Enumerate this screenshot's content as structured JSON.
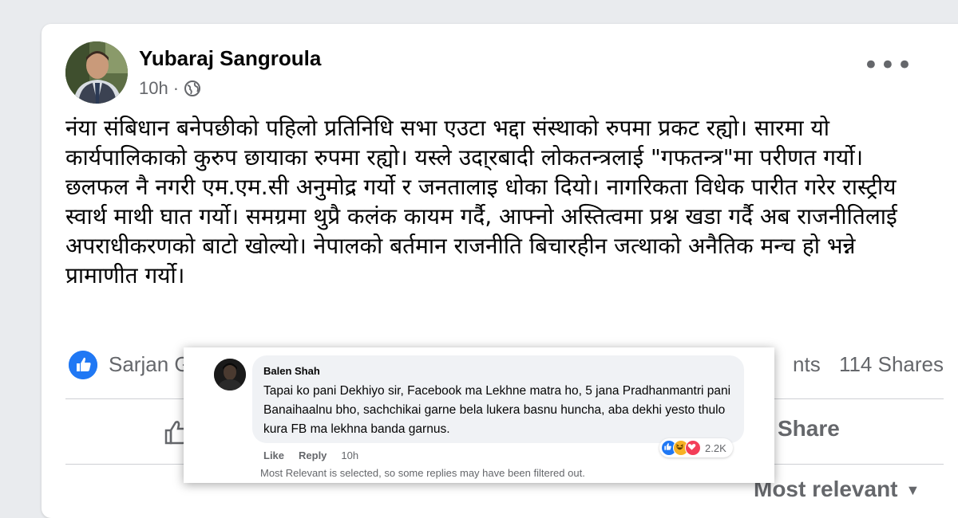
{
  "post": {
    "author": "Yubaraj Sangroula",
    "timestamp": "10h",
    "audience_icon": "globe-icon",
    "more_icon": "•••",
    "paragraph_1": "नंया संबिधान बनेपछीको पहिलो प्रतिनिधि सभा एउटा भद्दा संस्थाको रुपमा प्रकट रह्यो। सारमा यो कार्यपालिकाको कुरुप छायाका रुपमा रह्यो। यस्ले उदा्रबादी लोकतन्त्रलाई \"गफतन्त्र\"मा परीणत गर्यो।",
    "paragraph_2": "छलफल नै नगरी एम.एम.सी अनुमोद्र गर्यो र जनतालाइ धोका दियो। नागरिकता विधेक पारीत गरेर रास्ट्रीय स्वार्थ माथी घात गर्यो। समग्रमा थुप्रै कलंक कायम गर्दै, आफ्नो अस्तित्वमा प्रश्न खडा गर्दै अब राजनीतिलाई अपराधीकरणको बाटो खोल्यो। नेपालको बर्तमान राजनीति बिचारहीन जत्थाको अनैतिक मन्च हो भन्ने प्रामाणीत गर्यो।",
    "reactors_partial": "Sarjan G",
    "comments_partial": "nts",
    "shares": "114 Shares",
    "share_label": "Share",
    "sort_label": "Most relevant"
  },
  "comment": {
    "author": "Balen Shah",
    "text": "Tapai ko pani Dekhiyo sir, Facebook ma Lekhne matra ho, 5 jana Pradhanmantri pani Banaihaalnu bho, sachchikai garne bela lukera basnu huncha, aba dekhi yesto thulo kura FB ma lekhna banda garnus.",
    "like_label": "Like",
    "reply_label": "Reply",
    "time": "10h",
    "reaction_count": "2.2K",
    "filter_note": "Most Relevant is selected, so some replies may have been filtered out."
  },
  "colors": {
    "like_blue": "#2078f4",
    "haha_yellow": "#f7b125",
    "love_red": "#f33e58",
    "text_gray": "#65676b"
  }
}
